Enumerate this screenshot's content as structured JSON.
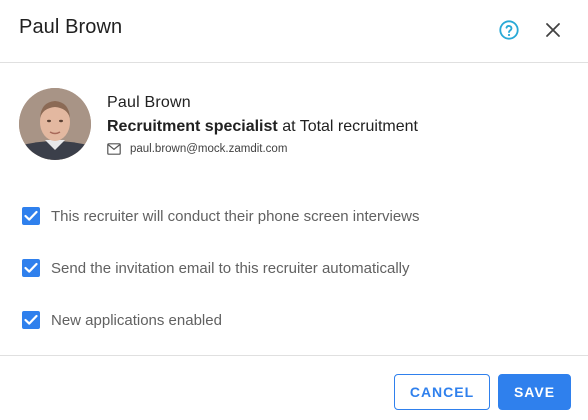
{
  "dialog": {
    "title": "Paul Brown",
    "help_icon": "help-circle-icon",
    "close_icon": "close-icon"
  },
  "profile": {
    "name": "Paul Brown",
    "role": "Recruitment specialist",
    "company_connector": "at",
    "company": "Total recruitment",
    "email": "paul.brown@mock.zamdit.com",
    "email_icon": "mail-icon"
  },
  "options": [
    {
      "label": "This recruiter will conduct their phone screen interviews",
      "checked": true
    },
    {
      "label": "Send the invitation email to this recruiter automatically",
      "checked": true
    },
    {
      "label": "New applications enabled",
      "checked": true
    }
  ],
  "footer": {
    "cancel_label": "CANCEL",
    "save_label": "SAVE"
  },
  "colors": {
    "accent": "#2f80ed",
    "help_icon": "#29a9d6"
  }
}
